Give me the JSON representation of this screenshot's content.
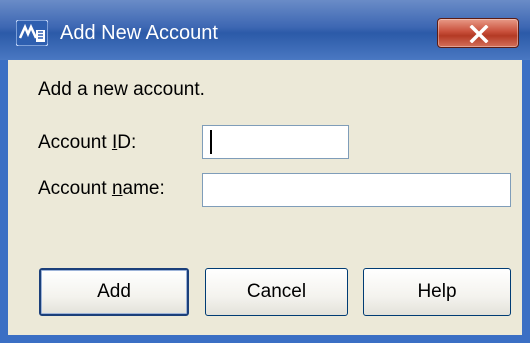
{
  "window": {
    "title": "Add New Account",
    "icon": "app-icon",
    "close_glyph": "X"
  },
  "dialog": {
    "instruction": "Add a new account.",
    "account_id": {
      "label_pre": "Account ",
      "label_accel": "I",
      "label_post": "D:",
      "value": ""
    },
    "account_name": {
      "label_pre": "Account ",
      "label_accel": "n",
      "label_post": "ame:",
      "value": ""
    }
  },
  "buttons": {
    "add": "Add",
    "cancel": "Cancel",
    "help": "Help"
  },
  "colors": {
    "titlebar": "#2b5aa8",
    "close": "#c9503b",
    "body": "#ece9d8",
    "field_border": "#7f9db9"
  }
}
